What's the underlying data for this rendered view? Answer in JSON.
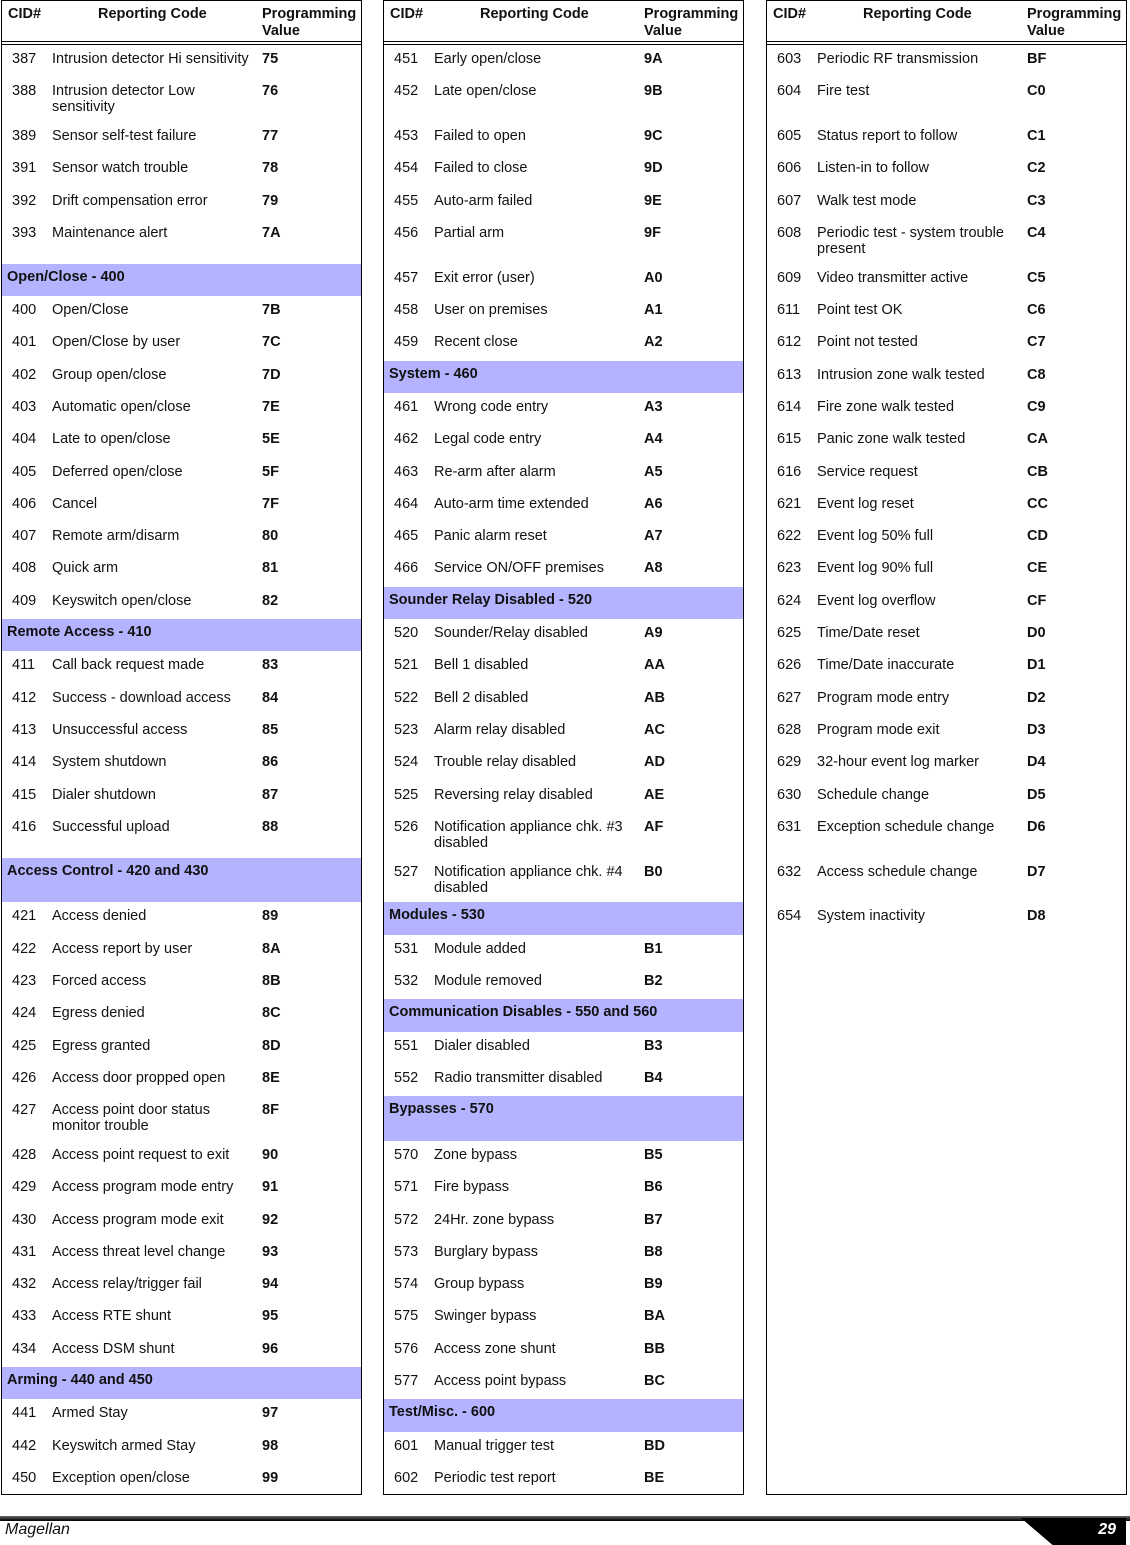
{
  "table_header": {
    "cid": "CID#",
    "code": "Reporting Code",
    "value_line1": "Programming",
    "value_line2": "Value"
  },
  "columns": [
    [
      {
        "cid": "387",
        "code": "Intrusion detector Hi sensitivity",
        "value": "75"
      },
      {
        "cid": "388",
        "code": "Intrusion detector Low sensitivity",
        "value": "76"
      },
      {
        "cid": "389",
        "code": "Sensor self-test failure",
        "value": "77"
      },
      {
        "cid": "391",
        "code": "Sensor watch trouble",
        "value": "78"
      },
      {
        "cid": "392",
        "code": "Drift compensation error",
        "value": "79"
      },
      {
        "cid": "393",
        "code": "Maintenance alert",
        "value": "7A"
      },
      {
        "section": "Open/Close - 400"
      },
      {
        "cid": "400",
        "code": "Open/Close",
        "value": "7B"
      },
      {
        "cid": "401",
        "code": "Open/Close by user",
        "value": "7C"
      },
      {
        "cid": "402",
        "code": "Group open/close",
        "value": "7D"
      },
      {
        "cid": "403",
        "code": "Automatic open/close",
        "value": "7E"
      },
      {
        "cid": "404",
        "code": "Late to open/close",
        "value": "5E"
      },
      {
        "cid": "405",
        "code": "Deferred open/close",
        "value": "5F"
      },
      {
        "cid": "406",
        "code": "Cancel",
        "value": "7F"
      },
      {
        "cid": "407",
        "code": "Remote arm/disarm",
        "value": "80"
      },
      {
        "cid": "408",
        "code": "Quick arm",
        "value": "81"
      },
      {
        "cid": "409",
        "code": "Keyswitch open/close",
        "value": "82"
      },
      {
        "section": "Remote Access - 410"
      },
      {
        "cid": "411",
        "code": "Call back request made",
        "value": "83"
      },
      {
        "cid": "412",
        "code": "Success - download access",
        "value": "84"
      },
      {
        "cid": "413",
        "code": "Unsuccessful access",
        "value": "85"
      },
      {
        "cid": "414",
        "code": "System shutdown",
        "value": "86"
      },
      {
        "cid": "415",
        "code": "Dialer shutdown",
        "value": "87"
      },
      {
        "cid": "416",
        "code": "Successful upload",
        "value": "88"
      },
      {
        "section": "Access Control - 420 and 430"
      },
      {
        "cid": "421",
        "code": "Access denied",
        "value": "89"
      },
      {
        "cid": "422",
        "code": "Access report by user",
        "value": "8A"
      },
      {
        "cid": "423",
        "code": "Forced access",
        "value": "8B"
      },
      {
        "cid": "424",
        "code": "Egress denied",
        "value": "8C"
      },
      {
        "cid": "425",
        "code": "Egress granted",
        "value": "8D"
      },
      {
        "cid": "426",
        "code": "Access door propped open",
        "value": "8E"
      },
      {
        "cid": "427",
        "code": "Access point door status monitor trouble",
        "value": "8F"
      },
      {
        "cid": "428",
        "code": "Access point request  to exit",
        "value": "90"
      },
      {
        "cid": "429",
        "code": "Access program mode entry",
        "value": "91"
      },
      {
        "cid": "430",
        "code": "Access program mode exit",
        "value": "92"
      },
      {
        "cid": "431",
        "code": "Access threat level change",
        "value": "93"
      },
      {
        "cid": "432",
        "code": "Access relay/trigger fail",
        "value": "94"
      },
      {
        "cid": "433",
        "code": "Access RTE shunt",
        "value": "95"
      },
      {
        "cid": "434",
        "code": "Access DSM shunt",
        "value": "96"
      },
      {
        "section": "Arming - 440 and 450"
      },
      {
        "cid": "441",
        "code": "Armed Stay",
        "value": "97"
      },
      {
        "cid": "442",
        "code": "Keyswitch armed Stay",
        "value": "98"
      },
      {
        "cid": "450",
        "code": "Exception open/close",
        "value": "99"
      }
    ],
    [
      {
        "cid": "451",
        "code": "Early open/close",
        "value": "9A"
      },
      {
        "cid": "452",
        "code": "Late open/close",
        "value": "9B"
      },
      {
        "cid": "453",
        "code": "Failed to open",
        "value": "9C"
      },
      {
        "cid": "454",
        "code": "Failed to close",
        "value": "9D"
      },
      {
        "cid": "455",
        "code": "Auto-arm failed",
        "value": "9E"
      },
      {
        "cid": "456",
        "code": "Partial arm",
        "value": "9F"
      },
      {
        "cid": "457",
        "code": "Exit error (user)",
        "value": "A0"
      },
      {
        "cid": "458",
        "code": "User on premises",
        "value": "A1"
      },
      {
        "cid": "459",
        "code": "Recent close",
        "value": "A2"
      },
      {
        "section": "System - 460"
      },
      {
        "cid": "461",
        "code": "Wrong code entry",
        "value": "A3"
      },
      {
        "cid": "462",
        "code": "Legal code entry",
        "value": "A4"
      },
      {
        "cid": "463",
        "code": "Re-arm after alarm",
        "value": "A5"
      },
      {
        "cid": "464",
        "code": "Auto-arm time extended",
        "value": "A6"
      },
      {
        "cid": "465",
        "code": "Panic alarm reset",
        "value": "A7"
      },
      {
        "cid": "466",
        "code": "Service ON/OFF premises",
        "value": "A8"
      },
      {
        "section": "Sounder Relay Disabled - 520"
      },
      {
        "cid": "520",
        "code": "Sounder/Relay disabled",
        "value": "A9"
      },
      {
        "cid": "521",
        "code": "Bell 1 disabled",
        "value": "AA"
      },
      {
        "cid": "522",
        "code": "Bell 2 disabled",
        "value": "AB"
      },
      {
        "cid": "523",
        "code": "Alarm relay disabled",
        "value": "AC"
      },
      {
        "cid": "524",
        "code": "Trouble relay disabled",
        "value": "AD"
      },
      {
        "cid": "525",
        "code": "Reversing relay disabled",
        "value": "AE"
      },
      {
        "cid": "526",
        "code": "Notification appliance chk. #3 disabled",
        "value": "AF"
      },
      {
        "cid": "527",
        "code": "Notification appliance chk. #4 disabled",
        "value": "B0"
      },
      {
        "section": "Modules - 530"
      },
      {
        "cid": "531",
        "code": "Module added",
        "value": "B1"
      },
      {
        "cid": "532",
        "code": "Module removed",
        "value": "B2"
      },
      {
        "section": "Communication Disables - 550 and 560"
      },
      {
        "cid": "551",
        "code": "Dialer disabled",
        "value": "B3"
      },
      {
        "cid": "552",
        "code": "Radio transmitter disabled",
        "value": "B4"
      },
      {
        "section": "Bypasses - 570"
      },
      {
        "cid": "570",
        "code": "Zone bypass",
        "value": "B5"
      },
      {
        "cid": "571",
        "code": "Fire bypass",
        "value": "B6"
      },
      {
        "cid": "572",
        "code": "24Hr. zone bypass",
        "value": "B7"
      },
      {
        "cid": "573",
        "code": "Burglary bypass",
        "value": "B8"
      },
      {
        "cid": "574",
        "code": "Group bypass",
        "value": "B9"
      },
      {
        "cid": "575",
        "code": "Swinger bypass",
        "value": "BA"
      },
      {
        "cid": "576",
        "code": "Access zone shunt",
        "value": "BB"
      },
      {
        "cid": "577",
        "code": "Access point bypass",
        "value": "BC"
      },
      {
        "section": "Test/Misc. - 600"
      },
      {
        "cid": "601",
        "code": "Manual trigger test",
        "value": "BD"
      },
      {
        "cid": "602",
        "code": "Periodic test report",
        "value": "BE"
      }
    ],
    [
      {
        "cid": "603",
        "code": "Periodic RF transmission",
        "value": "BF"
      },
      {
        "cid": "604",
        "code": "Fire test",
        "value": "C0"
      },
      {
        "cid": "605",
        "code": "Status report to follow",
        "value": "C1"
      },
      {
        "cid": "606",
        "code": "Listen-in to follow",
        "value": "C2"
      },
      {
        "cid": "607",
        "code": "Walk test mode",
        "value": "C3"
      },
      {
        "cid": "608",
        "code": "Periodic test  - system trouble present",
        "value": "C4"
      },
      {
        "cid": "609",
        "code": "Video transmitter active",
        "value": "C5"
      },
      {
        "cid": "611",
        "code": "Point test OK",
        "value": "C6"
      },
      {
        "cid": "612",
        "code": "Point not tested",
        "value": "C7"
      },
      {
        "cid": "613",
        "code": "Intrusion zone walk tested",
        "value": "C8"
      },
      {
        "cid": "614",
        "code": "Fire zone walk tested",
        "value": "C9"
      },
      {
        "cid": "615",
        "code": "Panic zone walk tested",
        "value": "CA"
      },
      {
        "cid": "616",
        "code": "Service request",
        "value": "CB"
      },
      {
        "cid": "621",
        "code": "Event log reset",
        "value": "CC"
      },
      {
        "cid": "622",
        "code": "Event log 50% full",
        "value": "CD"
      },
      {
        "cid": "623",
        "code": "Event log 90% full",
        "value": "CE"
      },
      {
        "cid": "624",
        "code": "Event log overflow",
        "value": "CF"
      },
      {
        "cid": "625",
        "code": "Time/Date reset",
        "value": "D0"
      },
      {
        "cid": "626",
        "code": "Time/Date inaccurate",
        "value": "D1"
      },
      {
        "cid": "627",
        "code": "Program mode entry",
        "value": "D2"
      },
      {
        "cid": "628",
        "code": "Program mode exit",
        "value": "D3"
      },
      {
        "cid": "629",
        "code": "32-hour event log marker",
        "value": "D4"
      },
      {
        "cid": "630",
        "code": "Schedule change",
        "value": "D5"
      },
      {
        "cid": "631",
        "code": "Exception schedule change",
        "value": "D6"
      },
      {
        "cid": "632",
        "code": "Access schedule change",
        "value": "D7"
      },
      {
        "cid": "654",
        "code": "System inactivity",
        "value": "D8"
      }
    ]
  ],
  "section_color": "#b3b3ff",
  "footer": {
    "title": "Magellan",
    "page": "29"
  }
}
